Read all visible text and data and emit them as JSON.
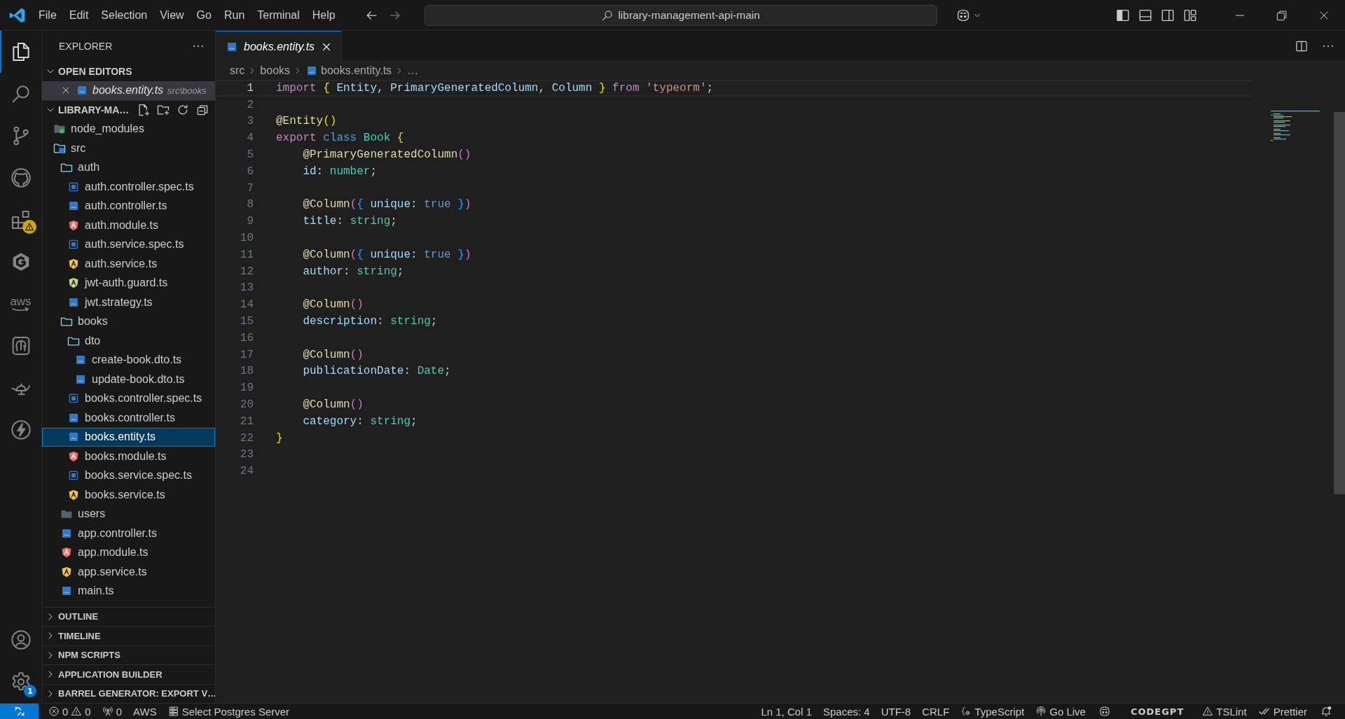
{
  "title_bar": {
    "menu": [
      "File",
      "Edit",
      "Selection",
      "View",
      "Go",
      "Run",
      "Terminal",
      "Help"
    ],
    "command_center": "library-management-api-main"
  },
  "activity_bar": {
    "top": [
      {
        "kind": "files",
        "selected": true,
        "warning": false
      },
      {
        "kind": "search",
        "selected": false,
        "warning": false
      },
      {
        "kind": "source-control",
        "selected": false,
        "warning": false
      },
      {
        "kind": "cat",
        "selected": false,
        "warning": false
      },
      {
        "kind": "extensions",
        "selected": false,
        "warning": true
      },
      {
        "kind": "hexagon",
        "selected": false,
        "warning": false
      },
      {
        "kind": "aws",
        "label": "aws",
        "selected": false,
        "warning": false
      },
      {
        "kind": "elephant",
        "selected": false,
        "warning": false
      },
      {
        "kind": "lamp",
        "selected": false,
        "warning": false
      },
      {
        "kind": "bolt",
        "selected": false,
        "warning": false
      }
    ],
    "bottom": [
      {
        "kind": "account"
      },
      {
        "kind": "settings",
        "badge": "1"
      }
    ]
  },
  "sidebar": {
    "title": "EXPLORER",
    "open_editors": {
      "title": "OPEN EDITORS",
      "expanded": true,
      "items": [
        {
          "name": "books.entity.ts",
          "path": "src\\books",
          "kind": "ts"
        }
      ]
    },
    "project": {
      "title": "LIBRARY-MA…",
      "expanded": true,
      "tree": [
        {
          "name": "node_modules",
          "kind": "node-folder",
          "expanded": false,
          "selected": false
        },
        {
          "name": "src",
          "kind": "src-folder",
          "expanded": true,
          "selected": false,
          "children": [
            {
              "name": "auth",
              "kind": "folder",
              "expanded": true,
              "selected": false,
              "children": [
                {
                  "name": "auth.controller.spec.ts",
                  "kind": "ts-spec",
                  "selected": false
                },
                {
                  "name": "auth.controller.ts",
                  "kind": "ts",
                  "selected": false
                },
                {
                  "name": "auth.module.ts",
                  "kind": "module",
                  "selected": false
                },
                {
                  "name": "auth.service.spec.ts",
                  "kind": "ts-spec",
                  "selected": false
                },
                {
                  "name": "auth.service.ts",
                  "kind": "service",
                  "selected": false
                },
                {
                  "name": "jwt-auth.guard.ts",
                  "kind": "guard",
                  "selected": false
                },
                {
                  "name": "jwt.strategy.ts",
                  "kind": "ts",
                  "selected": false
                }
              ]
            },
            {
              "name": "books",
              "kind": "folder",
              "expanded": true,
              "selected": false,
              "children": [
                {
                  "name": "dto",
                  "kind": "folder",
                  "expanded": true,
                  "selected": false,
                  "children": [
                    {
                      "name": "create-book.dto.ts",
                      "kind": "ts",
                      "selected": false
                    },
                    {
                      "name": "update-book.dto.ts",
                      "kind": "ts",
                      "selected": false
                    }
                  ]
                },
                {
                  "name": "books.controller.spec.ts",
                  "kind": "ts-spec",
                  "selected": false
                },
                {
                  "name": "books.controller.ts",
                  "kind": "ts",
                  "selected": false
                },
                {
                  "name": "books.entity.ts",
                  "kind": "ts",
                  "selected": true
                },
                {
                  "name": "books.module.ts",
                  "kind": "module",
                  "selected": false
                },
                {
                  "name": "books.service.spec.ts",
                  "kind": "ts-spec",
                  "selected": false
                },
                {
                  "name": "books.service.ts",
                  "kind": "service",
                  "selected": false
                }
              ]
            },
            {
              "name": "users",
              "kind": "folder",
              "expanded": false,
              "selected": false
            },
            {
              "name": "app.controller.ts",
              "kind": "ts",
              "selected": false
            },
            {
              "name": "app.module.ts",
              "kind": "module",
              "selected": false
            },
            {
              "name": "app.service.ts",
              "kind": "service",
              "selected": false
            },
            {
              "name": "main.ts",
              "kind": "ts",
              "selected": false
            }
          ]
        }
      ]
    },
    "sections": [
      {
        "title": "OUTLINE",
        "expanded": false
      },
      {
        "title": "TIMELINE",
        "expanded": false
      },
      {
        "title": "NPM SCRIPTS",
        "expanded": false
      },
      {
        "title": "APPLICATION BUILDER",
        "expanded": false
      },
      {
        "title": "BARREL GENERATOR: EXPORT V…",
        "expanded": false
      }
    ]
  },
  "editor": {
    "tabs": [
      {
        "label": "books.entity.ts",
        "kind": "ts",
        "selected": true
      }
    ],
    "breadcrumbs": [
      "src",
      "books",
      "books.entity.ts",
      "…"
    ],
    "lines": [
      {
        "number": "1",
        "current": true,
        "tokens": [
          {
            "text": "import",
            "kind": "control"
          },
          {
            "text": " {",
            "kind": "bracket1"
          },
          {
            "text": " Entity",
            "kind": "variable"
          },
          {
            "text": ", ",
            "kind": "plain"
          },
          {
            "text": "PrimaryGeneratedColumn",
            "kind": "variable"
          },
          {
            "text": ", ",
            "kind": "plain"
          },
          {
            "text": "Column",
            "kind": "variable"
          },
          {
            "text": " }",
            "kind": "bracket1"
          },
          {
            "text": " from",
            "kind": "control"
          },
          {
            "text": " 'typeorm'",
            "kind": "string"
          },
          {
            "text": ";",
            "kind": "plain"
          }
        ]
      },
      {
        "number": "2",
        "current": false
      },
      {
        "number": "3",
        "current": false,
        "tokens": [
          {
            "text": "@Entity",
            "kind": "decorator"
          },
          {
            "text": "()",
            "kind": "bracket1"
          }
        ]
      },
      {
        "number": "4",
        "current": false,
        "tokens": [
          {
            "text": "export",
            "kind": "control"
          },
          {
            "text": " class",
            "kind": "keyword"
          },
          {
            "text": " Book",
            "kind": "type"
          },
          {
            "text": " {",
            "kind": "bracket1"
          }
        ]
      },
      {
        "number": "5",
        "current": false,
        "tokens": [
          {
            "text": "    @PrimaryGeneratedColumn",
            "kind": "decorator"
          },
          {
            "text": "()",
            "kind": "bracket2"
          }
        ]
      },
      {
        "number": "6",
        "current": false,
        "tokens": [
          {
            "text": "    id",
            "kind": "variable"
          },
          {
            "text": ": ",
            "kind": "plain"
          },
          {
            "text": "number",
            "kind": "type"
          },
          {
            "text": ";",
            "kind": "plain"
          }
        ]
      },
      {
        "number": "7",
        "current": false
      },
      {
        "number": "8",
        "current": false,
        "tokens": [
          {
            "text": "    @Column",
            "kind": "decorator"
          },
          {
            "text": "(",
            "kind": "bracket2"
          },
          {
            "text": "{",
            "kind": "bracket3"
          },
          {
            "text": " unique",
            "kind": "variable"
          },
          {
            "text": ": ",
            "kind": "plain"
          },
          {
            "text": "true",
            "kind": "keyword"
          },
          {
            "text": " }",
            "kind": "bracket3"
          },
          {
            "text": ")",
            "kind": "bracket2"
          }
        ]
      },
      {
        "number": "9",
        "current": false,
        "tokens": [
          {
            "text": "    title",
            "kind": "variable"
          },
          {
            "text": ": ",
            "kind": "plain"
          },
          {
            "text": "string",
            "kind": "type"
          },
          {
            "text": ";",
            "kind": "plain"
          }
        ]
      },
      {
        "number": "10",
        "current": false
      },
      {
        "number": "11",
        "current": false,
        "tokens": [
          {
            "text": "    @Column",
            "kind": "decorator"
          },
          {
            "text": "(",
            "kind": "bracket2"
          },
          {
            "text": "{",
            "kind": "bracket3"
          },
          {
            "text": " unique",
            "kind": "variable"
          },
          {
            "text": ": ",
            "kind": "plain"
          },
          {
            "text": "true",
            "kind": "keyword"
          },
          {
            "text": " }",
            "kind": "bracket3"
          },
          {
            "text": ")",
            "kind": "bracket2"
          }
        ]
      },
      {
        "number": "12",
        "current": false,
        "tokens": [
          {
            "text": "    author",
            "kind": "variable"
          },
          {
            "text": ": ",
            "kind": "plain"
          },
          {
            "text": "string",
            "kind": "type"
          },
          {
            "text": ";",
            "kind": "plain"
          }
        ]
      },
      {
        "number": "13",
        "current": false
      },
      {
        "number": "14",
        "current": false,
        "tokens": [
          {
            "text": "    @Column",
            "kind": "decorator"
          },
          {
            "text": "()",
            "kind": "bracket2"
          }
        ]
      },
      {
        "number": "15",
        "current": false,
        "tokens": [
          {
            "text": "    description",
            "kind": "variable"
          },
          {
            "text": ": ",
            "kind": "plain"
          },
          {
            "text": "string",
            "kind": "type"
          },
          {
            "text": ";",
            "kind": "plain"
          }
        ]
      },
      {
        "number": "16",
        "current": false
      },
      {
        "number": "17",
        "current": false,
        "tokens": [
          {
            "text": "    @Column",
            "kind": "decorator"
          },
          {
            "text": "()",
            "kind": "bracket2"
          }
        ]
      },
      {
        "number": "18",
        "current": false,
        "tokens": [
          {
            "text": "    publicationDate",
            "kind": "variable"
          },
          {
            "text": ": ",
            "kind": "plain"
          },
          {
            "text": "Date",
            "kind": "type"
          },
          {
            "text": ";",
            "kind": "plain"
          }
        ]
      },
      {
        "number": "19",
        "current": false
      },
      {
        "number": "20",
        "current": false,
        "tokens": [
          {
            "text": "    @Column",
            "kind": "decorator"
          },
          {
            "text": "()",
            "kind": "bracket2"
          }
        ]
      },
      {
        "number": "21",
        "current": false,
        "tokens": [
          {
            "text": "    category",
            "kind": "variable"
          },
          {
            "text": ": ",
            "kind": "plain"
          },
          {
            "text": "string",
            "kind": "type"
          },
          {
            "text": ";",
            "kind": "plain"
          }
        ]
      },
      {
        "number": "22",
        "current": false,
        "tokens": [
          {
            "text": "}",
            "kind": "bracket1"
          }
        ]
      },
      {
        "number": "23",
        "current": false
      },
      {
        "number": "24",
        "current": false
      }
    ]
  },
  "status_bar": {
    "left": [
      {
        "kind": "remote"
      },
      {
        "kind": "problems",
        "errors": "0",
        "warnings": "0"
      },
      {
        "kind": "ports",
        "text": "0"
      },
      {
        "kind": "text",
        "text": "AWS"
      },
      {
        "kind": "server",
        "text": "Select Postgres Server"
      }
    ],
    "right": [
      {
        "kind": "text",
        "text": "Ln 1, Col 1"
      },
      {
        "kind": "text",
        "text": "Spaces: 4"
      },
      {
        "kind": "text",
        "text": "UTF-8"
      },
      {
        "kind": "text",
        "text": "CRLF"
      },
      {
        "kind": "language",
        "text": "TypeScript"
      },
      {
        "kind": "broadcast",
        "text": "Go Live"
      },
      {
        "kind": "copilot"
      },
      {
        "kind": "logo",
        "text": "CODEGPT"
      },
      {
        "kind": "warning",
        "text": "TSLint"
      },
      {
        "kind": "check",
        "text": "Prettier"
      },
      {
        "kind": "bell"
      }
    ]
  }
}
